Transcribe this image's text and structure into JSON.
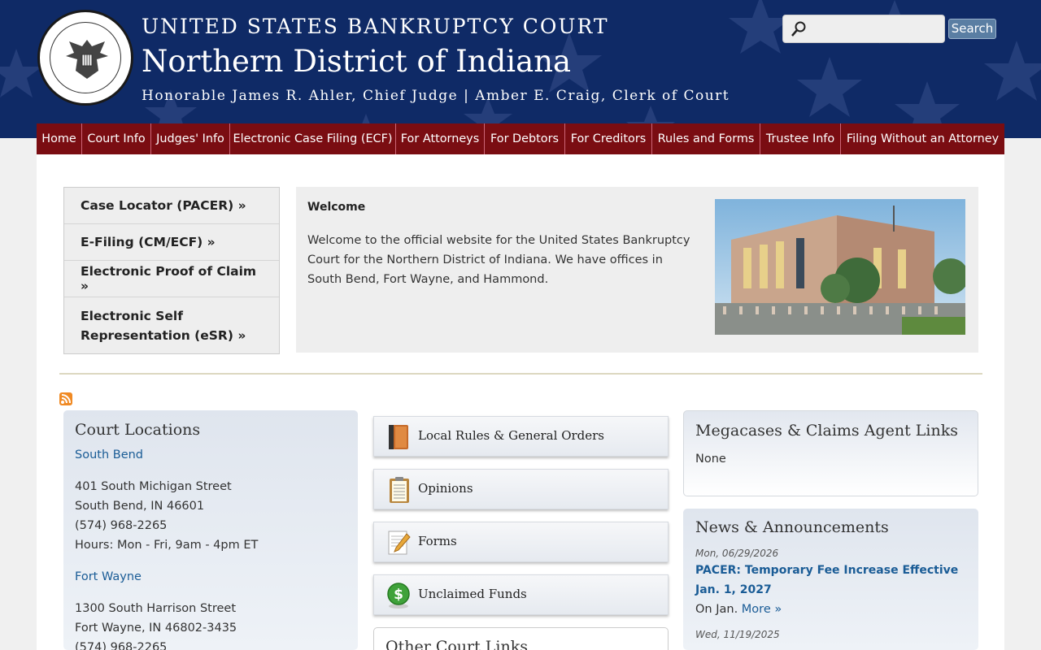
{
  "header": {
    "title_line1": "UNITED STATES BANKRUPTCY COURT",
    "title_line2": "Northern District of Indiana",
    "title_line3": "Honorable James R. Ahler, Chief Judge | Amber E. Craig, Clerk of Court",
    "search_placeholder": "",
    "search_button": "Search"
  },
  "nav": [
    {
      "label": "Home"
    },
    {
      "label": "Court Info"
    },
    {
      "label": "Judges' Info"
    },
    {
      "label": "Electronic Case Filing (ECF)"
    },
    {
      "label": "For Attorneys"
    },
    {
      "label": "For Debtors"
    },
    {
      "label": "For Creditors"
    },
    {
      "label": "Rules and Forms"
    },
    {
      "label": "Trustee Info"
    },
    {
      "label": "Filing Without an Attorney"
    }
  ],
  "quick_links": [
    {
      "label": "Case Locator (PACER) »"
    },
    {
      "label": "E-Filing (CM/ECF) »"
    },
    {
      "label": "Electronic Proof of Claim »"
    },
    {
      "label": "Electronic Self Representation (eSR) »"
    }
  ],
  "welcome": {
    "heading": "Welcome",
    "body": "Welcome to the official website for the United States Bankruptcy Court for the Northern District of Indiana. We have offices in South Bend, Fort Wayne, and Hammond."
  },
  "locations": {
    "heading": "Court Locations",
    "items": [
      {
        "name": "South Bend",
        "line1": "401 South Michigan Street",
        "line2": "South Bend, IN 46601",
        "phone": "(574) 968-2265",
        "hours": "Hours: Mon - Fri, 9am - 4pm ET"
      },
      {
        "name": "Fort Wayne",
        "line1": "1300 South Harrison Street",
        "line2": "Fort Wayne, IN 46802-3435",
        "phone": "(574) 968-2265"
      }
    ]
  },
  "resource_links": [
    {
      "label": "Local Rules & General Orders",
      "icon": "book-icon"
    },
    {
      "label": "Opinions",
      "icon": "clipboard-icon"
    },
    {
      "label": "Forms",
      "icon": "form-pencil-icon"
    },
    {
      "label": "Unclaimed Funds",
      "icon": "dollar-coin-icon"
    }
  ],
  "other_links": {
    "heading": "Other Court Links"
  },
  "megacases": {
    "heading": "Megacases & Claims Agent Links",
    "body": "None"
  },
  "news": {
    "heading": "News & Announcements",
    "items": [
      {
        "date": "Mon, 06/29/2026",
        "headline": "PACER: Temporary Fee Increase Effective Jan. 1, 2027",
        "snippet": "On Jan.",
        "more": "More »"
      },
      {
        "date": "Wed, 11/19/2025"
      }
    ]
  },
  "colors": {
    "header_bg": "#0f2a66",
    "nav_bg": "#7a0d12",
    "link": "#1a5c96"
  }
}
